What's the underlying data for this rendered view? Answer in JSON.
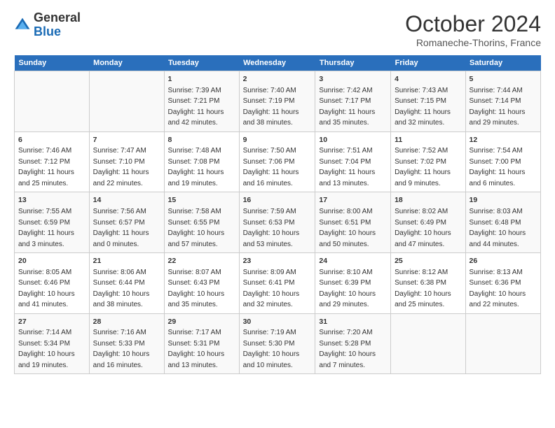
{
  "logo": {
    "general": "General",
    "blue": "Blue"
  },
  "title": "October 2024",
  "location": "Romaneche-Thorins, France",
  "days_header": [
    "Sunday",
    "Monday",
    "Tuesday",
    "Wednesday",
    "Thursday",
    "Friday",
    "Saturday"
  ],
  "weeks": [
    [
      {
        "day": "",
        "sunrise": "",
        "sunset": "",
        "daylight": ""
      },
      {
        "day": "",
        "sunrise": "",
        "sunset": "",
        "daylight": ""
      },
      {
        "day": "1",
        "sunrise": "Sunrise: 7:39 AM",
        "sunset": "Sunset: 7:21 PM",
        "daylight": "Daylight: 11 hours and 42 minutes."
      },
      {
        "day": "2",
        "sunrise": "Sunrise: 7:40 AM",
        "sunset": "Sunset: 7:19 PM",
        "daylight": "Daylight: 11 hours and 38 minutes."
      },
      {
        "day": "3",
        "sunrise": "Sunrise: 7:42 AM",
        "sunset": "Sunset: 7:17 PM",
        "daylight": "Daylight: 11 hours and 35 minutes."
      },
      {
        "day": "4",
        "sunrise": "Sunrise: 7:43 AM",
        "sunset": "Sunset: 7:15 PM",
        "daylight": "Daylight: 11 hours and 32 minutes."
      },
      {
        "day": "5",
        "sunrise": "Sunrise: 7:44 AM",
        "sunset": "Sunset: 7:14 PM",
        "daylight": "Daylight: 11 hours and 29 minutes."
      }
    ],
    [
      {
        "day": "6",
        "sunrise": "Sunrise: 7:46 AM",
        "sunset": "Sunset: 7:12 PM",
        "daylight": "Daylight: 11 hours and 25 minutes."
      },
      {
        "day": "7",
        "sunrise": "Sunrise: 7:47 AM",
        "sunset": "Sunset: 7:10 PM",
        "daylight": "Daylight: 11 hours and 22 minutes."
      },
      {
        "day": "8",
        "sunrise": "Sunrise: 7:48 AM",
        "sunset": "Sunset: 7:08 PM",
        "daylight": "Daylight: 11 hours and 19 minutes."
      },
      {
        "day": "9",
        "sunrise": "Sunrise: 7:50 AM",
        "sunset": "Sunset: 7:06 PM",
        "daylight": "Daylight: 11 hours and 16 minutes."
      },
      {
        "day": "10",
        "sunrise": "Sunrise: 7:51 AM",
        "sunset": "Sunset: 7:04 PM",
        "daylight": "Daylight: 11 hours and 13 minutes."
      },
      {
        "day": "11",
        "sunrise": "Sunrise: 7:52 AM",
        "sunset": "Sunset: 7:02 PM",
        "daylight": "Daylight: 11 hours and 9 minutes."
      },
      {
        "day": "12",
        "sunrise": "Sunrise: 7:54 AM",
        "sunset": "Sunset: 7:00 PM",
        "daylight": "Daylight: 11 hours and 6 minutes."
      }
    ],
    [
      {
        "day": "13",
        "sunrise": "Sunrise: 7:55 AM",
        "sunset": "Sunset: 6:59 PM",
        "daylight": "Daylight: 11 hours and 3 minutes."
      },
      {
        "day": "14",
        "sunrise": "Sunrise: 7:56 AM",
        "sunset": "Sunset: 6:57 PM",
        "daylight": "Daylight: 11 hours and 0 minutes."
      },
      {
        "day": "15",
        "sunrise": "Sunrise: 7:58 AM",
        "sunset": "Sunset: 6:55 PM",
        "daylight": "Daylight: 10 hours and 57 minutes."
      },
      {
        "day": "16",
        "sunrise": "Sunrise: 7:59 AM",
        "sunset": "Sunset: 6:53 PM",
        "daylight": "Daylight: 10 hours and 53 minutes."
      },
      {
        "day": "17",
        "sunrise": "Sunrise: 8:00 AM",
        "sunset": "Sunset: 6:51 PM",
        "daylight": "Daylight: 10 hours and 50 minutes."
      },
      {
        "day": "18",
        "sunrise": "Sunrise: 8:02 AM",
        "sunset": "Sunset: 6:49 PM",
        "daylight": "Daylight: 10 hours and 47 minutes."
      },
      {
        "day": "19",
        "sunrise": "Sunrise: 8:03 AM",
        "sunset": "Sunset: 6:48 PM",
        "daylight": "Daylight: 10 hours and 44 minutes."
      }
    ],
    [
      {
        "day": "20",
        "sunrise": "Sunrise: 8:05 AM",
        "sunset": "Sunset: 6:46 PM",
        "daylight": "Daylight: 10 hours and 41 minutes."
      },
      {
        "day": "21",
        "sunrise": "Sunrise: 8:06 AM",
        "sunset": "Sunset: 6:44 PM",
        "daylight": "Daylight: 10 hours and 38 minutes."
      },
      {
        "day": "22",
        "sunrise": "Sunrise: 8:07 AM",
        "sunset": "Sunset: 6:43 PM",
        "daylight": "Daylight: 10 hours and 35 minutes."
      },
      {
        "day": "23",
        "sunrise": "Sunrise: 8:09 AM",
        "sunset": "Sunset: 6:41 PM",
        "daylight": "Daylight: 10 hours and 32 minutes."
      },
      {
        "day": "24",
        "sunrise": "Sunrise: 8:10 AM",
        "sunset": "Sunset: 6:39 PM",
        "daylight": "Daylight: 10 hours and 29 minutes."
      },
      {
        "day": "25",
        "sunrise": "Sunrise: 8:12 AM",
        "sunset": "Sunset: 6:38 PM",
        "daylight": "Daylight: 10 hours and 25 minutes."
      },
      {
        "day": "26",
        "sunrise": "Sunrise: 8:13 AM",
        "sunset": "Sunset: 6:36 PM",
        "daylight": "Daylight: 10 hours and 22 minutes."
      }
    ],
    [
      {
        "day": "27",
        "sunrise": "Sunrise: 7:14 AM",
        "sunset": "Sunset: 5:34 PM",
        "daylight": "Daylight: 10 hours and 19 minutes."
      },
      {
        "day": "28",
        "sunrise": "Sunrise: 7:16 AM",
        "sunset": "Sunset: 5:33 PM",
        "daylight": "Daylight: 10 hours and 16 minutes."
      },
      {
        "day": "29",
        "sunrise": "Sunrise: 7:17 AM",
        "sunset": "Sunset: 5:31 PM",
        "daylight": "Daylight: 10 hours and 13 minutes."
      },
      {
        "day": "30",
        "sunrise": "Sunrise: 7:19 AM",
        "sunset": "Sunset: 5:30 PM",
        "daylight": "Daylight: 10 hours and 10 minutes."
      },
      {
        "day": "31",
        "sunrise": "Sunrise: 7:20 AM",
        "sunset": "Sunset: 5:28 PM",
        "daylight": "Daylight: 10 hours and 7 minutes."
      },
      {
        "day": "",
        "sunrise": "",
        "sunset": "",
        "daylight": ""
      },
      {
        "day": "",
        "sunrise": "",
        "sunset": "",
        "daylight": ""
      }
    ]
  ]
}
